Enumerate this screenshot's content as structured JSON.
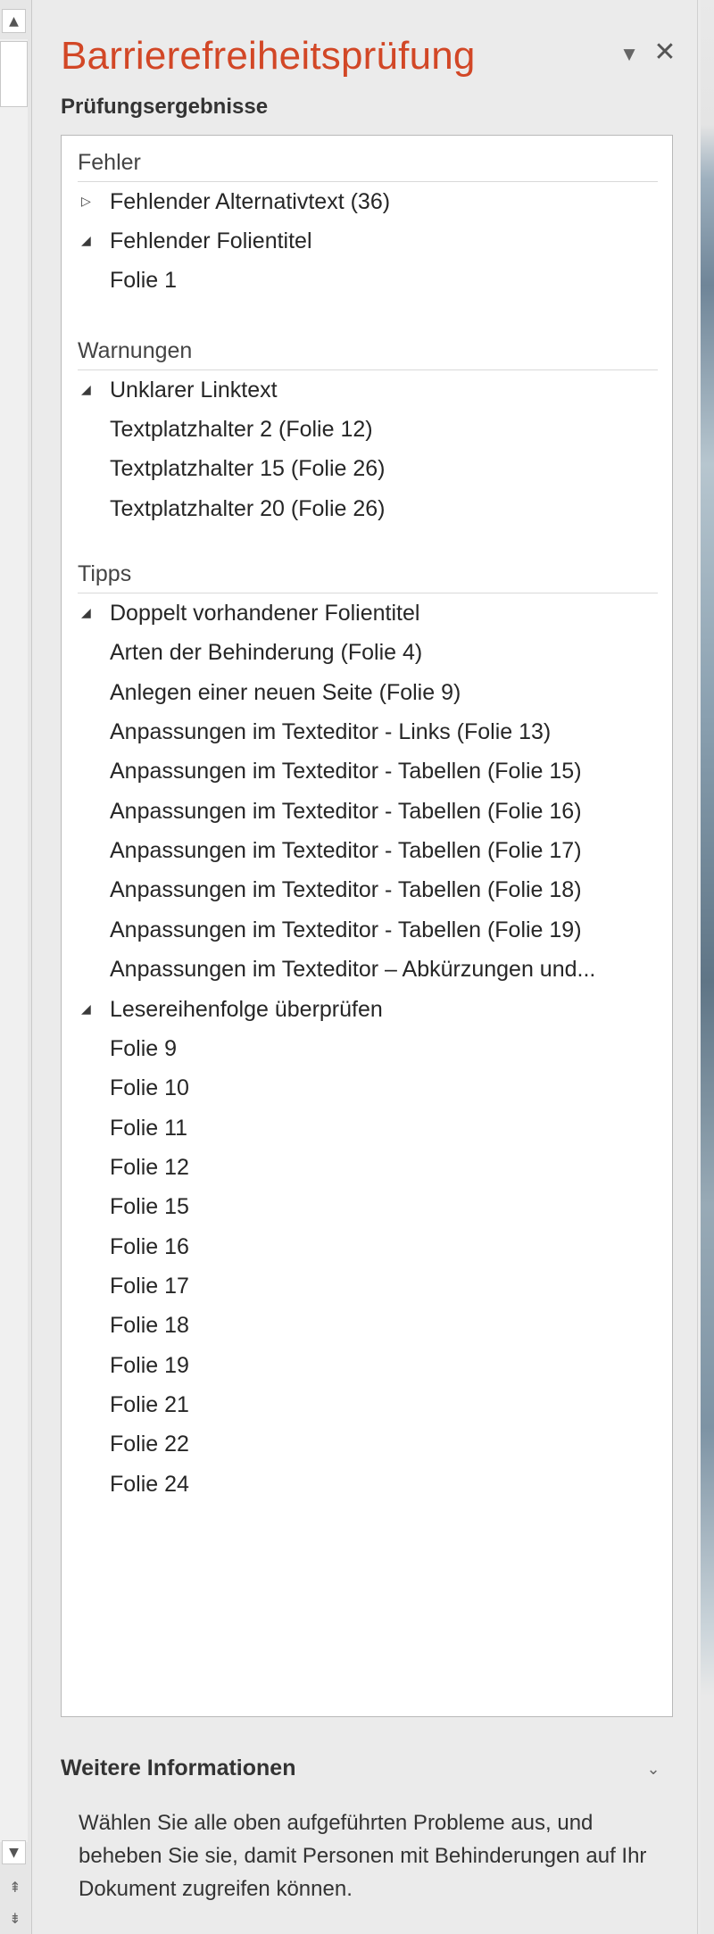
{
  "pane": {
    "title": "Barrierefreiheitsprüfung",
    "title_color": "#d24726",
    "subtitle": "Prüfungsergebnisse",
    "menu_icon": "dropdown-caret-icon",
    "close_icon": "close-icon"
  },
  "groups": {
    "errors": {
      "label": "Fehler",
      "categories": [
        {
          "label": "Fehlender Alternativtext (36)",
          "expanded": false,
          "items": []
        },
        {
          "label": "Fehlender Folientitel",
          "expanded": true,
          "items": [
            "Folie 1"
          ]
        }
      ]
    },
    "warnings": {
      "label": "Warnungen",
      "categories": [
        {
          "label": "Unklarer Linktext",
          "expanded": true,
          "items": [
            "Textplatzhalter 2  (Folie 12)",
            "Textplatzhalter 15  (Folie 26)",
            "Textplatzhalter 20  (Folie 26)"
          ]
        }
      ]
    },
    "tips": {
      "label": "Tipps",
      "categories": [
        {
          "label": "Doppelt vorhandener Folientitel",
          "expanded": true,
          "items": [
            "Arten der Behinderung (Folie 4)",
            "Anlegen einer neuen Seite (Folie 9)",
            "Anpassungen im Texteditor - Links (Folie 13)",
            "Anpassungen im Texteditor - Tabellen (Folie 15)",
            "Anpassungen im Texteditor - Tabellen (Folie 16)",
            "Anpassungen im Texteditor - Tabellen (Folie 17)",
            "Anpassungen im Texteditor - Tabellen (Folie 18)",
            "Anpassungen im Texteditor - Tabellen (Folie 19)",
            "Anpassungen im Texteditor – Abkürzungen und..."
          ]
        },
        {
          "label": "Lesereihenfolge überprüfen",
          "expanded": true,
          "items": [
            "Folie 9",
            "Folie 10",
            "Folie 11",
            "Folie 12",
            "Folie 15",
            "Folie 16",
            "Folie 17",
            "Folie 18",
            "Folie 19",
            "Folie 21",
            "Folie 22",
            "Folie 24"
          ]
        }
      ]
    }
  },
  "more_info": {
    "label": "Weitere Informationen",
    "chevron_icon": "chevron-down-icon",
    "text": "Wählen Sie alle oben aufgeführten Probleme aus, und beheben Sie sie, damit Personen mit Behinderungen auf Ihr Dokument zugreifen können."
  },
  "icons": {
    "expanded": "triangle-expanded-icon",
    "collapsed": "triangle-collapsed-icon",
    "scroll_up": "scroll-up-arrow-icon",
    "scroll_down": "scroll-down-arrow-icon",
    "previous_slide": "previous-slide-icon",
    "next_slide": "next-slide-icon"
  }
}
